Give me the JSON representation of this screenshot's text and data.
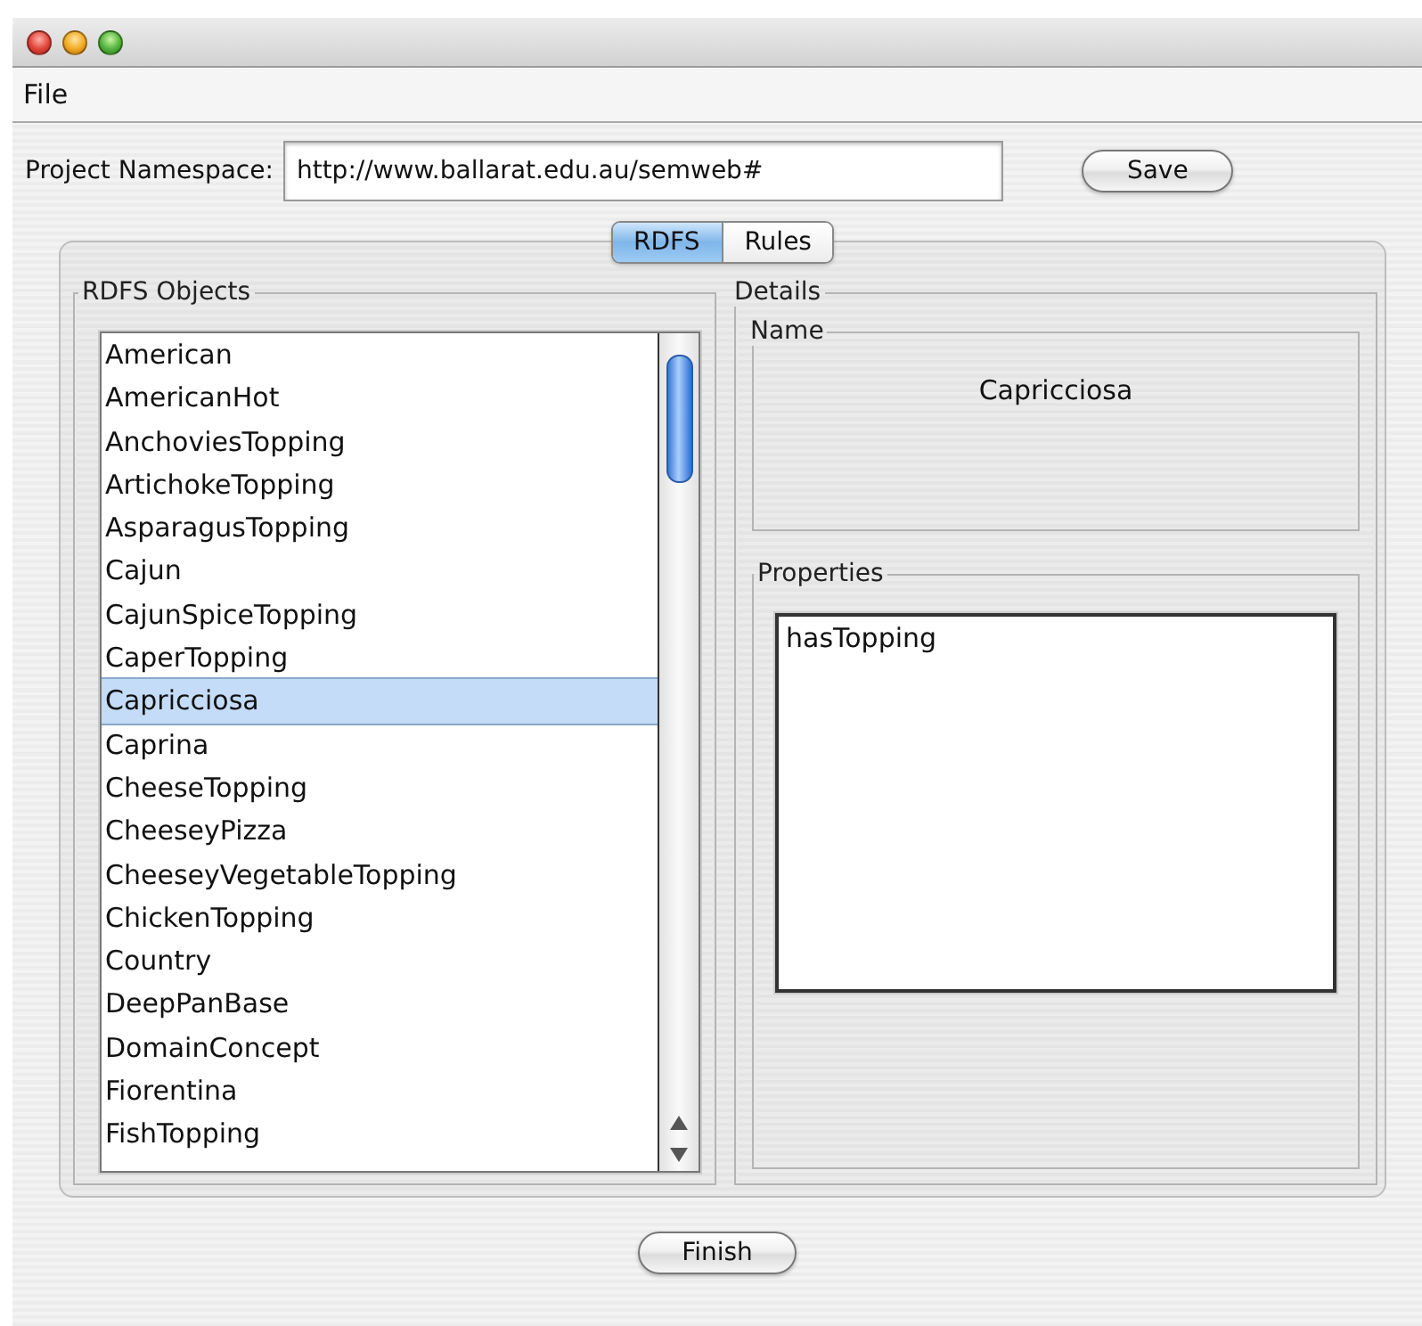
{
  "window": {
    "controls": [
      {
        "kind": "close"
      },
      {
        "kind": "minimize"
      },
      {
        "kind": "zoom"
      }
    ]
  },
  "menu": [
    {
      "label": "File"
    }
  ],
  "namespace": {
    "label": "Project Namespace:",
    "value": "http://www.ballarat.edu.au/semweb#"
  },
  "save_button": "Save",
  "tabs": [
    {
      "label": "RDFS",
      "selected": true
    },
    {
      "label": "Rules",
      "selected": false
    }
  ],
  "rdfs_objects": {
    "title": "RDFS Objects",
    "items": [
      {
        "label": "American",
        "selected": false
      },
      {
        "label": "AmericanHot",
        "selected": false
      },
      {
        "label": "AnchoviesTopping",
        "selected": false
      },
      {
        "label": "ArtichokeTopping",
        "selected": false
      },
      {
        "label": "AsparagusTopping",
        "selected": false
      },
      {
        "label": "Cajun",
        "selected": false
      },
      {
        "label": "CajunSpiceTopping",
        "selected": false
      },
      {
        "label": "CaperTopping",
        "selected": false
      },
      {
        "label": "Capricciosa",
        "selected": true
      },
      {
        "label": "Caprina",
        "selected": false
      },
      {
        "label": "CheeseTopping",
        "selected": false
      },
      {
        "label": "CheeseyPizza",
        "selected": false
      },
      {
        "label": "CheeseyVegetableTopping",
        "selected": false
      },
      {
        "label": "ChickenTopping",
        "selected": false
      },
      {
        "label": "Country",
        "selected": false
      },
      {
        "label": "DeepPanBase",
        "selected": false
      },
      {
        "label": "DomainConcept",
        "selected": false
      },
      {
        "label": "Fiorentina",
        "selected": false
      },
      {
        "label": "FishTopping",
        "selected": false
      }
    ]
  },
  "details": {
    "title": "Details",
    "name": {
      "title": "Name",
      "value": "Capricciosa"
    },
    "properties": {
      "title": "Properties",
      "items": [
        {
          "label": "hasTopping"
        }
      ]
    }
  },
  "finish_button": "Finish"
}
